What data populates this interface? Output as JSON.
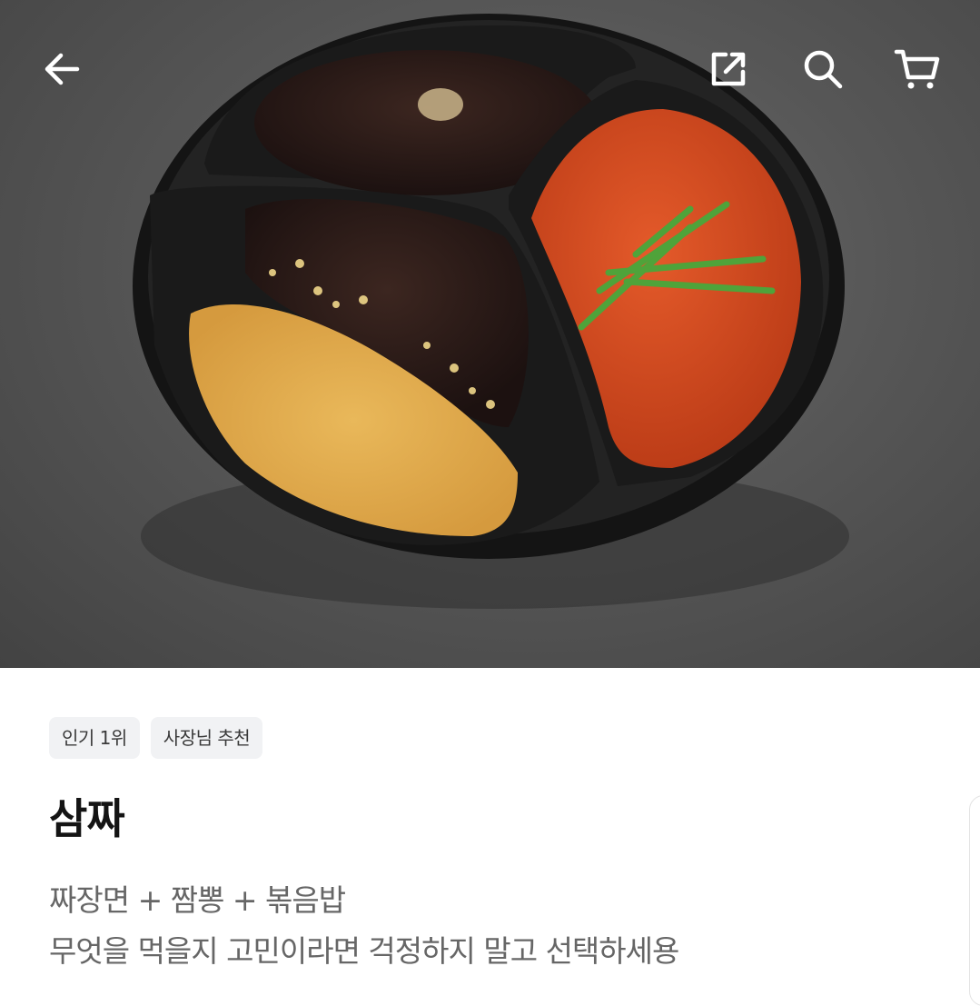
{
  "header": {
    "back_icon": "arrow-left-icon",
    "share_icon": "share-icon",
    "search_icon": "search-icon",
    "cart_icon": "cart-icon"
  },
  "product": {
    "image": "food-tray-photo",
    "tags": [
      "인기 1위",
      "사장님 추천"
    ],
    "name": "삼짜",
    "description_line1": "짜장면 + 짬뽕 + 볶음밥",
    "description_line2": "무엇을 먹을지 고민이라면 걱정하지 말고 선택하세용"
  }
}
